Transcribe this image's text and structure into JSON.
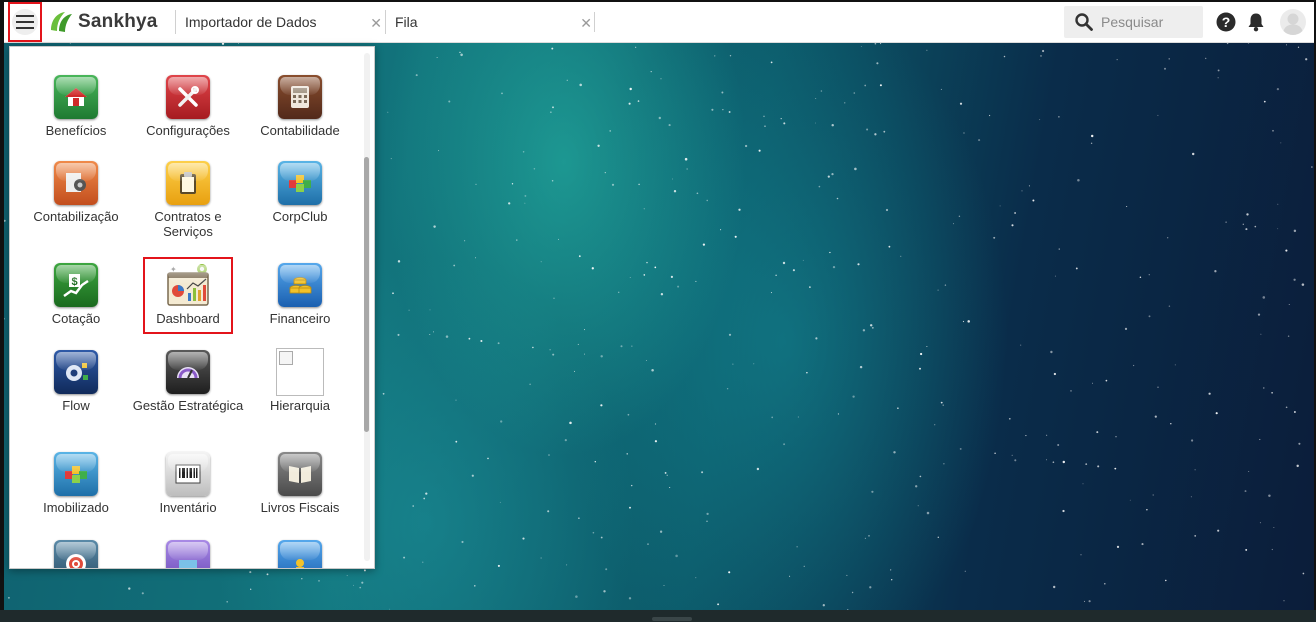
{
  "app": {
    "brand": "Sankhya",
    "brand_color": "#6abf3b",
    "selection_color": "#e3141b"
  },
  "tabs": [
    {
      "label": "Importador de Dados"
    },
    {
      "label": "Fila"
    }
  ],
  "search": {
    "placeholder": "Pesquisar"
  },
  "icons": {
    "menu": "hamburger-icon",
    "help": "question-circle-icon",
    "notifications": "bell-icon",
    "user": "user-avatar-icon"
  },
  "menu": {
    "items": [
      {
        "label": "Benefícios",
        "icon": "house-icon",
        "color": "#2e9a43"
      },
      {
        "label": "Configurações",
        "icon": "tools-icon",
        "color": "#c8262c"
      },
      {
        "label": "Contabilidade",
        "icon": "calculator-icon",
        "color": "#6b3a22"
      },
      {
        "label": "Contabilização",
        "icon": "gear-document-icon",
        "color": "#e06a2a"
      },
      {
        "label": "Contratos e Serviços",
        "icon": "clipboard-icon",
        "color": "#f2b014"
      },
      {
        "label": "CorpClub",
        "icon": "cubes-icon",
        "color": "#2d8fc9"
      },
      {
        "label": "Cotação",
        "icon": "dollar-chart-icon",
        "color": "#2a8a2e"
      },
      {
        "label": "Dashboard",
        "icon": "dashboard-chart-icon",
        "color": "#f0e4c8"
      },
      {
        "label": "Financeiro",
        "icon": "coins-icon",
        "color": "#2b86d6"
      },
      {
        "label": "Flow",
        "icon": "flow-gear-icon",
        "color": "#1e3d7a"
      },
      {
        "label": "Gestão Estratégica",
        "icon": "gauge-icon",
        "color": "#3a3a3a"
      },
      {
        "label": "Hierarquia",
        "icon": "broken-image-icon",
        "color": "#ffffff"
      },
      {
        "label": "Imobilizado",
        "icon": "cubes-icon",
        "color": "#2d8fc9"
      },
      {
        "label": "Inventário",
        "icon": "barcode-icon",
        "color": "#4a4a4a"
      },
      {
        "label": "Livros Fiscais",
        "icon": "book-icon",
        "color": "#6c6c6c"
      },
      {
        "label": "",
        "icon": "target-icon",
        "color": "#3a6e8a"
      },
      {
        "label": "",
        "icon": "window-icon",
        "color": "#7a5cc4"
      },
      {
        "label": "",
        "icon": "person-icon",
        "color": "#2b86d6"
      }
    ],
    "selected": "Dashboard"
  }
}
